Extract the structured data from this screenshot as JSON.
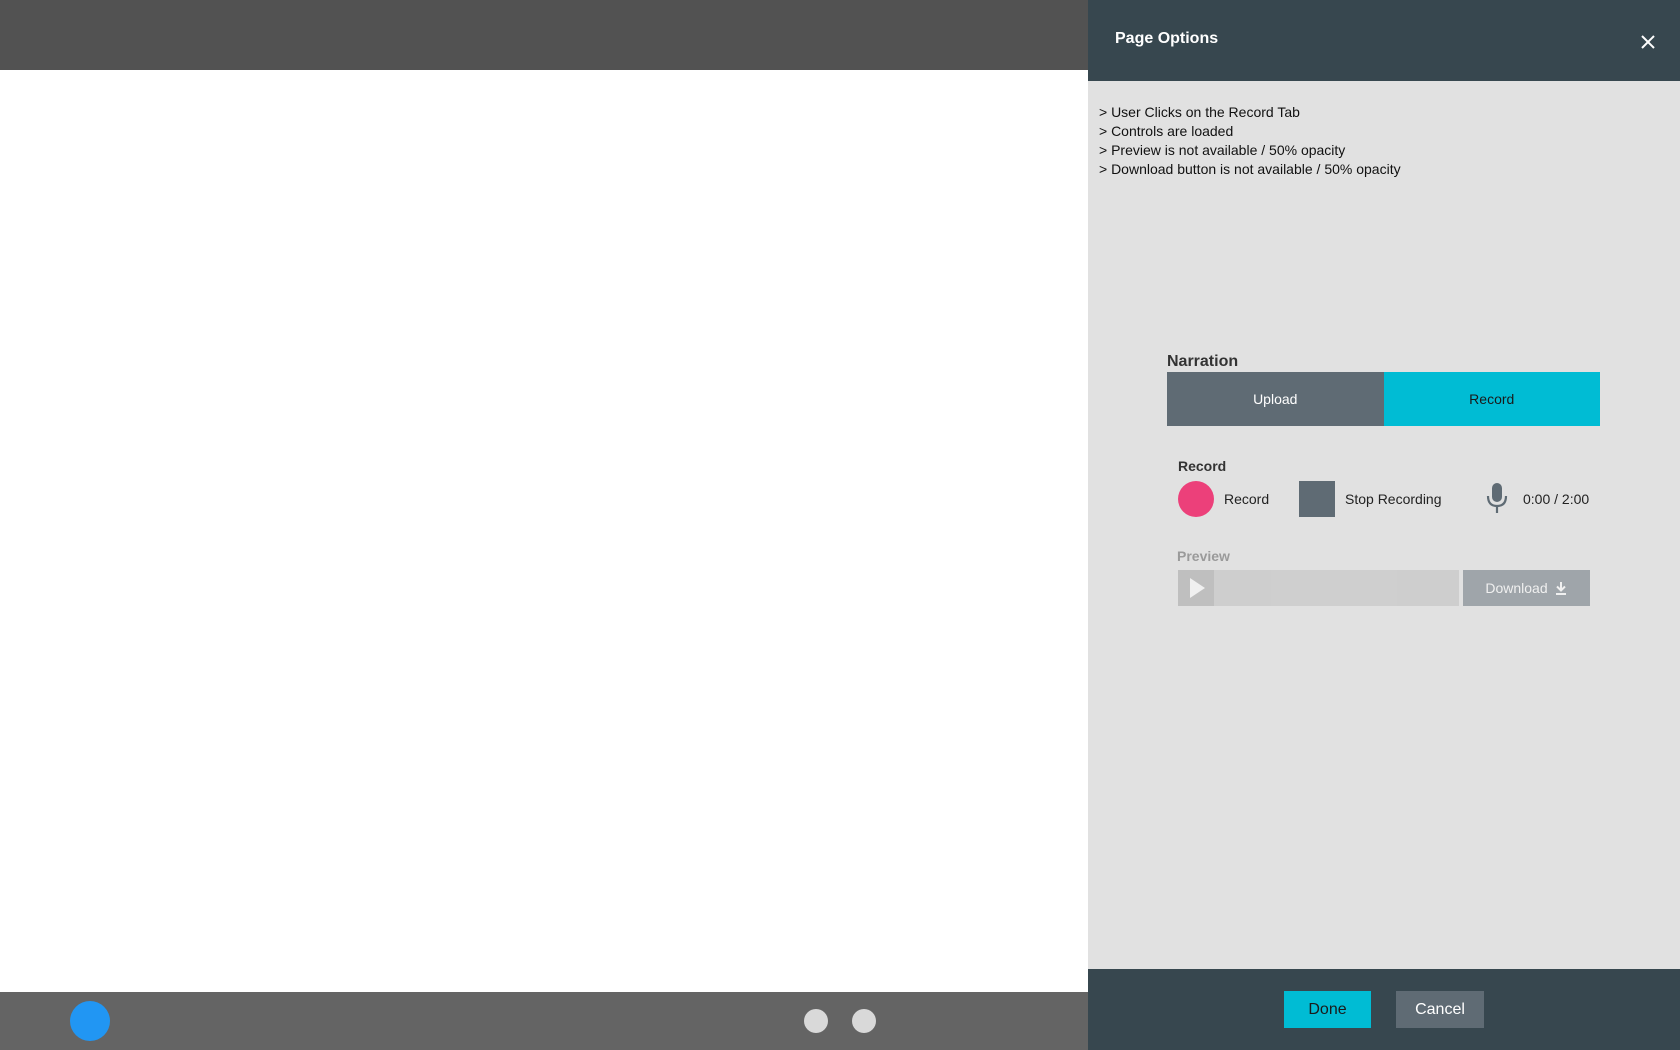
{
  "panel": {
    "title": "Page Options",
    "notes": [
      "> User Clicks on the Record Tab",
      "> Controls are loaded",
      "> Preview is not available / 50% opacity",
      "> Download button is not available / 50% opacity"
    ]
  },
  "narration": {
    "label": "Narration",
    "tabs": [
      {
        "label": "Upload",
        "active": false
      },
      {
        "label": "Record",
        "active": true
      }
    ]
  },
  "record": {
    "label": "Record",
    "record_button_label": "Record",
    "stop_button_label": "Stop Recording",
    "timer": "0:00 / 2:00"
  },
  "preview": {
    "label": "Preview",
    "download_label": "Download",
    "disabled": true
  },
  "footer": {
    "done_label": "Done",
    "cancel_label": "Cancel"
  },
  "colors": {
    "header_bg": "#37474f",
    "panel_bg": "#e1e1e1",
    "accent": "#00bcd4",
    "record_red": "#ec407a",
    "slate": "#5f6b74",
    "active_page_dot": "#2196f3"
  },
  "icons": [
    "close-icon",
    "microphone-icon",
    "play-icon",
    "download-icon"
  ]
}
